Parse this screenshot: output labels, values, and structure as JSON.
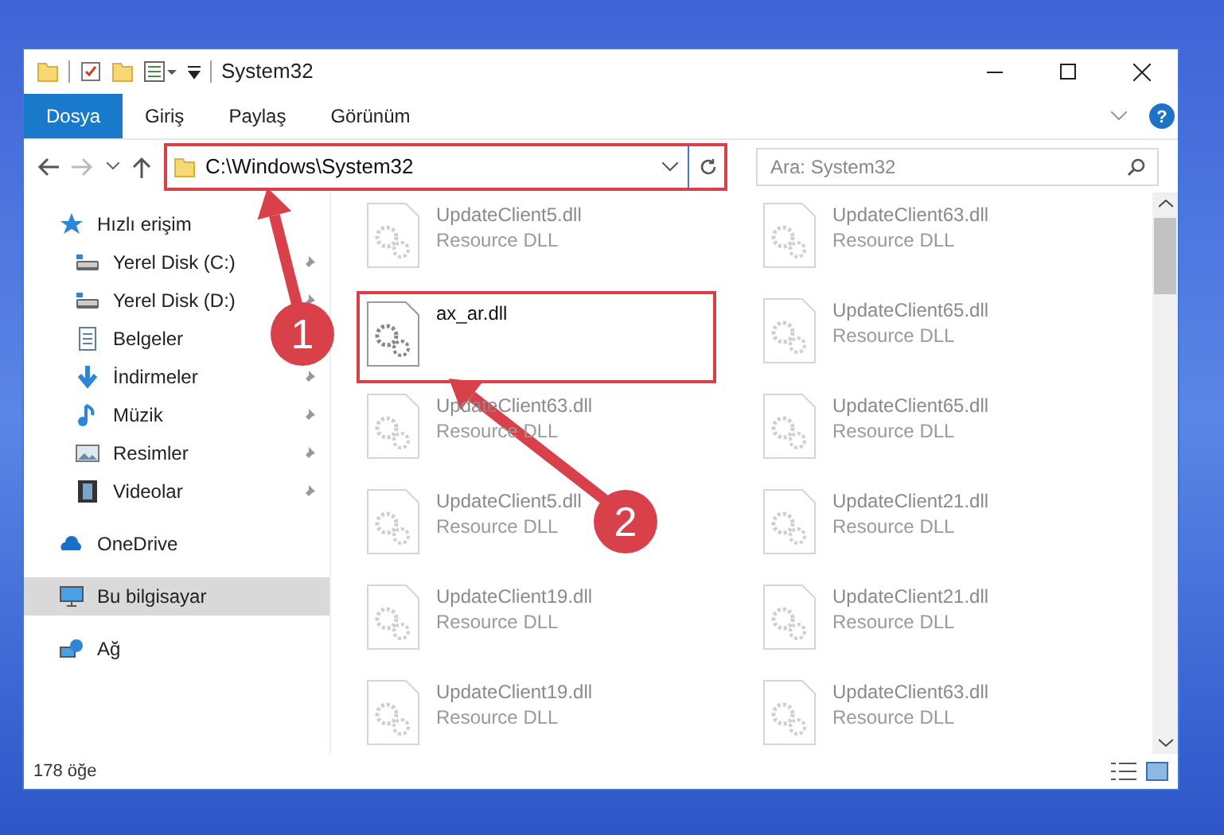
{
  "window": {
    "title": "System32"
  },
  "ribbon_tabs": [
    {
      "label": "Dosya",
      "selected": true
    },
    {
      "label": "Giriş",
      "selected": false
    },
    {
      "label": "Paylaş",
      "selected": false
    },
    {
      "label": "Görünüm",
      "selected": false
    }
  ],
  "address": {
    "path": "C:\\Windows\\System32",
    "highlighted": true
  },
  "search": {
    "placeholder": "Ara: System32"
  },
  "help": {
    "label": "?"
  },
  "sidebar": {
    "items": [
      {
        "label": "Hızlı erişim",
        "kind": "star",
        "selected": false,
        "children": [
          {
            "label": "Yerel Disk (C:)",
            "kind": "disk",
            "pinned": true
          },
          {
            "label": "Yerel Disk (D:)",
            "kind": "disk",
            "pinned": true
          },
          {
            "label": "Belgeler",
            "kind": "doc"
          },
          {
            "label": "İndirmeler",
            "kind": "download",
            "pinned": true
          },
          {
            "label": "Müzik",
            "kind": "music",
            "pinned": true
          },
          {
            "label": "Resimler",
            "kind": "picture",
            "pinned": true
          },
          {
            "label": "Videolar",
            "kind": "video",
            "pinned": true
          }
        ]
      },
      {
        "label": "OneDrive",
        "kind": "cloud",
        "selected": false
      },
      {
        "label": "Bu bilgisayar",
        "kind": "pc",
        "selected": true
      },
      {
        "label": "Ağ",
        "kind": "network",
        "selected": false
      }
    ]
  },
  "files": [
    {
      "name": "UpdateClient5.dll",
      "type": "Resource DLL",
      "highlighted": false
    },
    {
      "name": "UpdateClient63.dll",
      "type": "Resource DLL",
      "highlighted": false
    },
    {
      "name": "ax_ar.dll",
      "highlighted": true
    },
    {
      "name": "UpdateClient65.dll",
      "type": "Resource DLL",
      "highlighted": false
    },
    {
      "name": "UpdateClient63.dll",
      "type": "Resource DLL",
      "highlighted": false
    },
    {
      "name": "UpdateClient65.dll",
      "type": "Resource DLL",
      "highlighted": false
    },
    {
      "name": "UpdateClient5.dll",
      "type": "Resource DLL",
      "highlighted": false
    },
    {
      "name": "UpdateClient21.dll",
      "type": "Resource DLL",
      "highlighted": false
    },
    {
      "name": "UpdateClient19.dll",
      "type": "Resource DLL",
      "highlighted": false
    },
    {
      "name": "UpdateClient21.dll",
      "type": "Resource DLL",
      "highlighted": false
    },
    {
      "name": "UpdateClient19.dll",
      "type": "Resource DLL",
      "highlighted": false
    },
    {
      "name": "UpdateClient63.dll",
      "type": "Resource DLL",
      "highlighted": false
    }
  ],
  "status_bar": {
    "count": "178 öğe"
  },
  "callouts": [
    {
      "number": "1"
    },
    {
      "number": "2"
    }
  ]
}
